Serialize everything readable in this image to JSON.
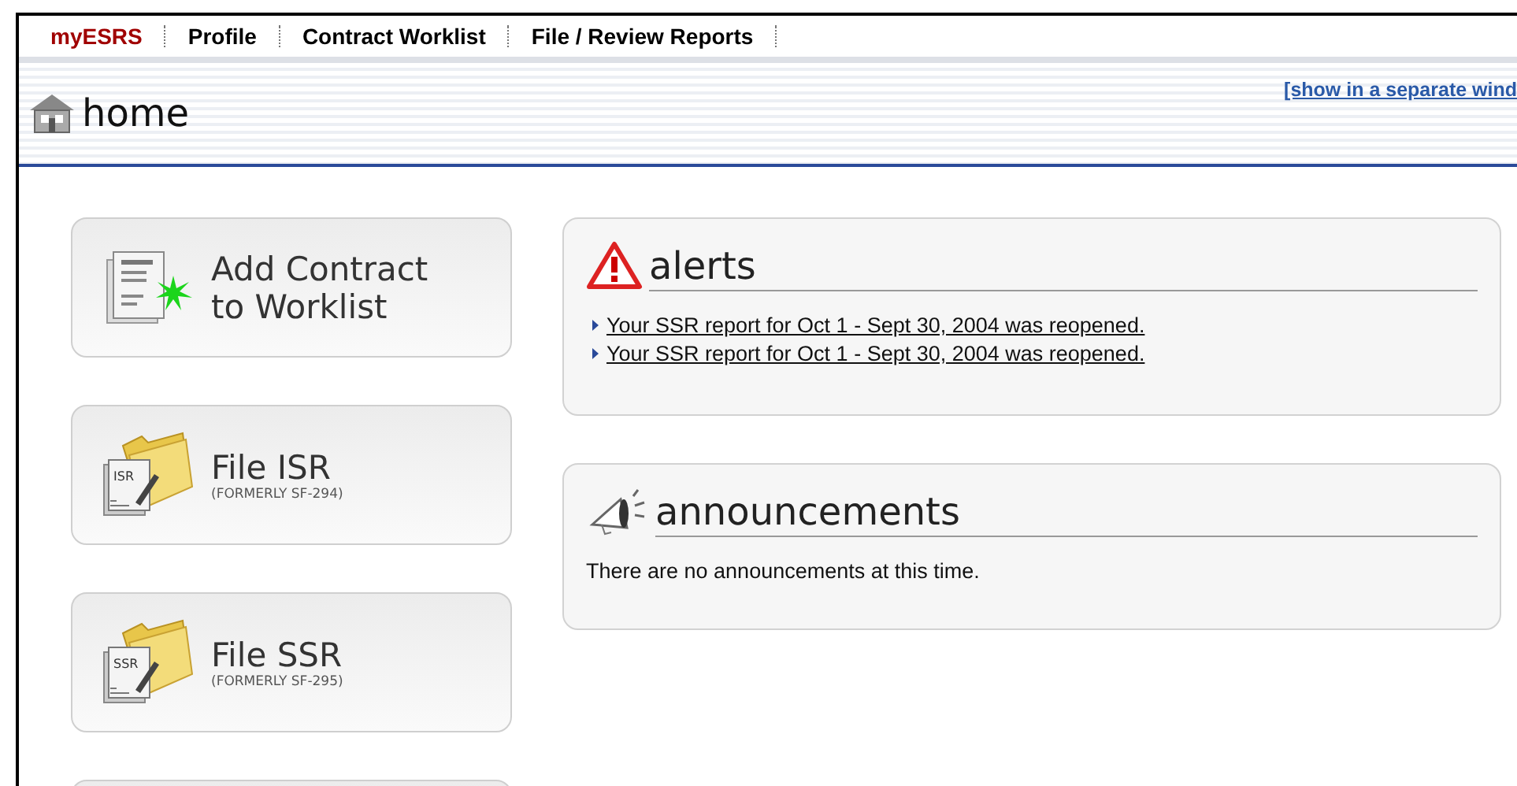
{
  "nav": [
    {
      "label": "myESRS",
      "selected": true
    },
    {
      "label": "Profile",
      "selected": false
    },
    {
      "label": "Contract Worklist",
      "selected": false
    },
    {
      "label": "File / Review Reports",
      "selected": false
    }
  ],
  "header": {
    "title": "home",
    "link": "[show in a separate wind"
  },
  "actions": [
    {
      "kind": "add",
      "title": "Add Contract to Worklist"
    },
    {
      "kind": "folder",
      "title": "File ISR",
      "subtitle": "(FORMERLY SF-294)",
      "icon_label": "ISR"
    },
    {
      "kind": "folder",
      "title": "File SSR",
      "subtitle": "(FORMERLY SF-295)",
      "icon_label": "SSR"
    },
    {
      "kind": "blank"
    }
  ],
  "alerts": {
    "title": "alerts",
    "items": [
      "Your SSR report for Oct 1 - Sept 30, 2004 was reopened.",
      "Your SSR report for Oct 1 - Sept 30, 2004 was reopened."
    ]
  },
  "announcements": {
    "title": "announcements",
    "message": "There are no announcements at this time."
  }
}
